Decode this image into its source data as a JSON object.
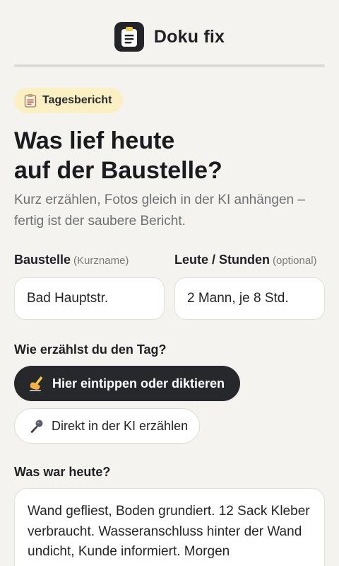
{
  "app": {
    "title": "Doku fix"
  },
  "icons": {
    "logo": "clipboard-icon",
    "badge": "clipboard-icon",
    "type_button": "writing-hand-icon",
    "ki_button": "microphone-icon"
  },
  "colors": {
    "background": "#f4f3ef",
    "primary_dark": "#27282b",
    "badge_bg": "#fbefc4",
    "muted_text": "#6e6f72"
  },
  "badge": {
    "label": "Tagesbericht"
  },
  "headline": {
    "line1": "Was lief heute",
    "line2": "auf der Baustelle?"
  },
  "subtext": "Kurz erzählen, Fotos gleich in der KI anhängen – fertig ist der saubere Bericht.",
  "form": {
    "site": {
      "label": "Baustelle",
      "hint": "(Kurzname)",
      "value": "Bad Hauptstr."
    },
    "crew": {
      "label": "Leute / Stunden",
      "hint": "(optional)",
      "value": "2 Mann, je 8 Std."
    }
  },
  "mode": {
    "question": "Wie erzählst du den Tag?",
    "type_label": "Hier eintippen oder diktieren",
    "ki_label": "Direkt in der KI erzählen"
  },
  "today": {
    "question": "Was war heute?",
    "text": "Wand gefliest, Boden grundiert. 12 Sack Kleber verbraucht. Wasseranschluss hinter der Wand undicht, Kunde informiert. Morgen"
  }
}
